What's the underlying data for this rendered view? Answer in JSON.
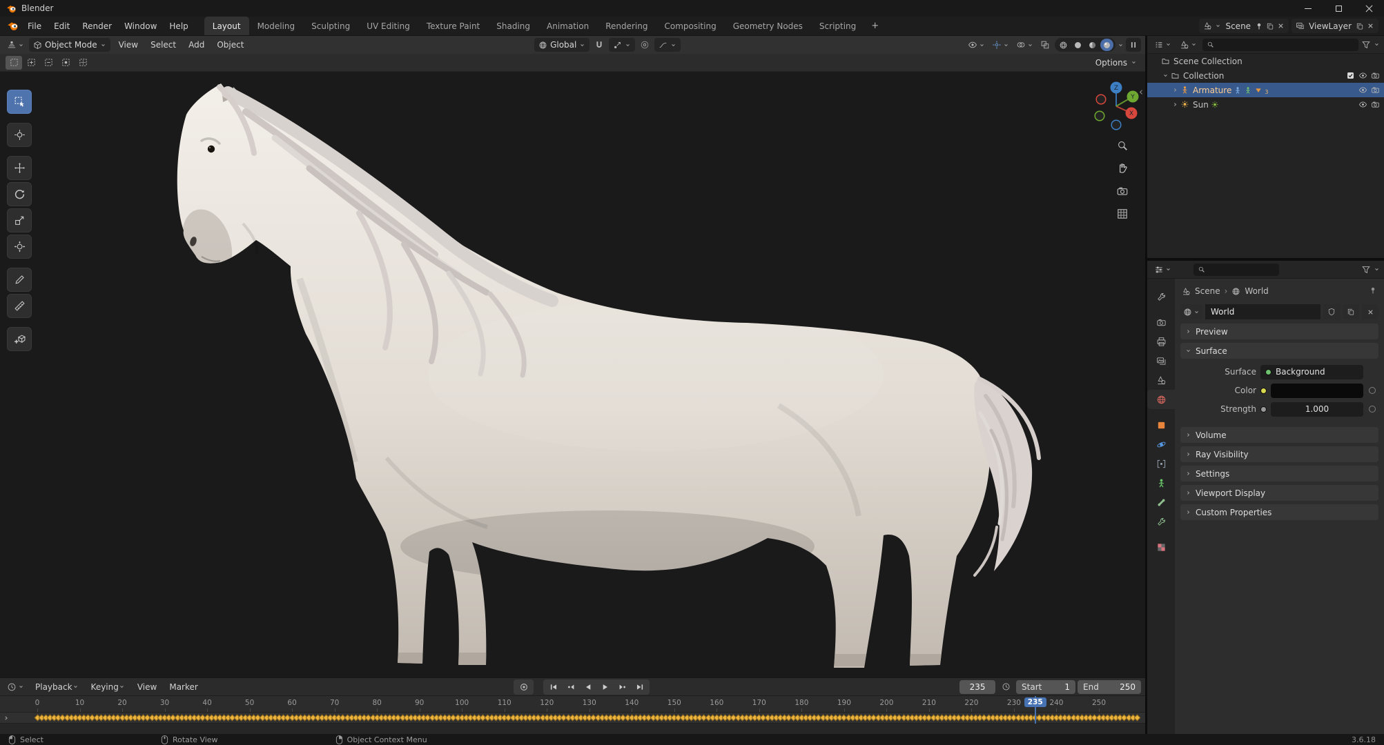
{
  "window": {
    "title": "Blender"
  },
  "topbar": {
    "menus": [
      "File",
      "Edit",
      "Render",
      "Window",
      "Help"
    ],
    "workspaces": [
      "Layout",
      "Modeling",
      "Sculpting",
      "UV Editing",
      "Texture Paint",
      "Shading",
      "Animation",
      "Rendering",
      "Compositing",
      "Geometry Nodes",
      "Scripting"
    ],
    "active_workspace": "Layout",
    "add_workspace_label": "+",
    "scene_label": "Scene",
    "view_layer_label": "ViewLayer"
  },
  "viewport_header": {
    "mode_label": "Object Mode",
    "menus": [
      "View",
      "Select",
      "Add",
      "Object"
    ],
    "orientation_label": "Global",
    "options_label": "Options",
    "select_modes": [
      "new",
      "extend",
      "subtract",
      "invert",
      "intersect"
    ],
    "active_select_mode": "new",
    "toggles": [
      "object-visibility",
      "gizmos",
      "overlays",
      "xray"
    ],
    "shading_modes": [
      "wireframe",
      "solid",
      "material-preview",
      "rendered"
    ],
    "active_shading_mode": "rendered"
  },
  "toolbar": {
    "tools": [
      "tweak-select",
      "cursor",
      "move",
      "rotate",
      "scale",
      "transform",
      "annotate",
      "measure",
      "add-cube"
    ],
    "active_tool": "tweak-select"
  },
  "nav_gizmo": {
    "axes": [
      {
        "label": "Z",
        "color": "#3d7fc4"
      },
      {
        "label": "X",
        "color": "#d8473c"
      },
      {
        "label": "Y",
        "color": "#6fa830"
      }
    ],
    "buttons": [
      "zoom",
      "pan",
      "camera-view",
      "projection"
    ]
  },
  "outliner": {
    "rows": [
      {
        "label": "Scene Collection",
        "icon": "collection",
        "indent": 0,
        "expand": null,
        "selected": false,
        "child_icons": [],
        "toggles": []
      },
      {
        "label": "Collection",
        "icon": "collection",
        "indent": 1,
        "expand": "open",
        "selected": false,
        "child_icons": [],
        "toggles": [
          "checkbox",
          "eye",
          "camera"
        ]
      },
      {
        "label": "Armature",
        "icon": "armature",
        "indent": 2,
        "expand": "closed",
        "selected": true,
        "badge": "3",
        "child_icons": [
          "pose",
          "armature-data",
          "vertex-group"
        ],
        "toggles": [
          "eye",
          "camera"
        ]
      },
      {
        "label": "Sun",
        "icon": "light",
        "indent": 2,
        "expand": "closed",
        "selected": false,
        "child_icons": [
          "sun-data"
        ],
        "toggles": [
          "eye",
          "camera"
        ]
      }
    ]
  },
  "properties": {
    "breadcrumb": [
      {
        "label": "Scene",
        "icon": "scene"
      },
      {
        "label": "World",
        "icon": "world"
      }
    ],
    "datablock_name": "World",
    "tabs": [
      {
        "name": "tool",
        "color": "#b0b0b0"
      },
      {
        "name": "render",
        "color": "#b0b0b0",
        "gap_before": true
      },
      {
        "name": "output",
        "color": "#b0b0b0"
      },
      {
        "name": "view-layer",
        "color": "#b0b0b0"
      },
      {
        "name": "scene",
        "color": "#b0b0b0"
      },
      {
        "name": "world",
        "color": "#d4675f",
        "active": true
      },
      {
        "name": "object",
        "color": "#e8853c",
        "gap_before": true
      },
      {
        "name": "physics",
        "color": "#5796e0"
      },
      {
        "name": "constraints",
        "color": "#9aa7b5"
      },
      {
        "name": "data",
        "color": "#67c668"
      },
      {
        "name": "bone",
        "color": "#8fbf8f"
      },
      {
        "name": "bone-constraints",
        "color": "#8fbf8f"
      },
      {
        "name": "texture",
        "color": "#d8727e",
        "gap_before": true
      }
    ],
    "panels": [
      {
        "title": "Preview",
        "expanded": false
      },
      {
        "title": "Surface",
        "expanded": true
      },
      {
        "title": "Volume",
        "expanded": false
      },
      {
        "title": "Ray Visibility",
        "expanded": false
      },
      {
        "title": "Settings",
        "expanded": false
      },
      {
        "title": "Viewport Display",
        "expanded": false
      },
      {
        "title": "Custom Properties",
        "expanded": false
      }
    ],
    "surface": {
      "surface_label": "Surface",
      "surface_value": "Background",
      "color_label": "Color",
      "strength_label": "Strength",
      "strength_value": "1.000",
      "socket_colors": {
        "shader": "#6ec16e",
        "color": "#d9d94d",
        "value": "#9a9a9a"
      }
    }
  },
  "timeline": {
    "menus": [
      {
        "label": "Playback",
        "chevron": true
      },
      {
        "label": "Keying",
        "chevron": true
      },
      {
        "label": "View",
        "chevron": false
      },
      {
        "label": "Marker",
        "chevron": false
      }
    ],
    "transport": [
      "jump-start",
      "prev-keyframe",
      "play-reverse",
      "play",
      "next-keyframe",
      "jump-end"
    ],
    "current_frame": "235",
    "start_label": "Start",
    "start_value": "1",
    "end_label": "End",
    "end_value": "250",
    "ruler": {
      "min": 0,
      "max": 250,
      "label_step": 10
    },
    "keyframes": {
      "first": 0,
      "last": 259,
      "step": 1
    },
    "keyframe_color": "#eeb53e",
    "playhead_color": "#4772b3"
  },
  "statusbar": {
    "hints": [
      {
        "button": "left",
        "label": "Select"
      },
      {
        "button": "middle",
        "label": "Rotate View"
      },
      {
        "button": "right",
        "label": "Object Context Menu"
      }
    ],
    "version": "3.6.18"
  }
}
